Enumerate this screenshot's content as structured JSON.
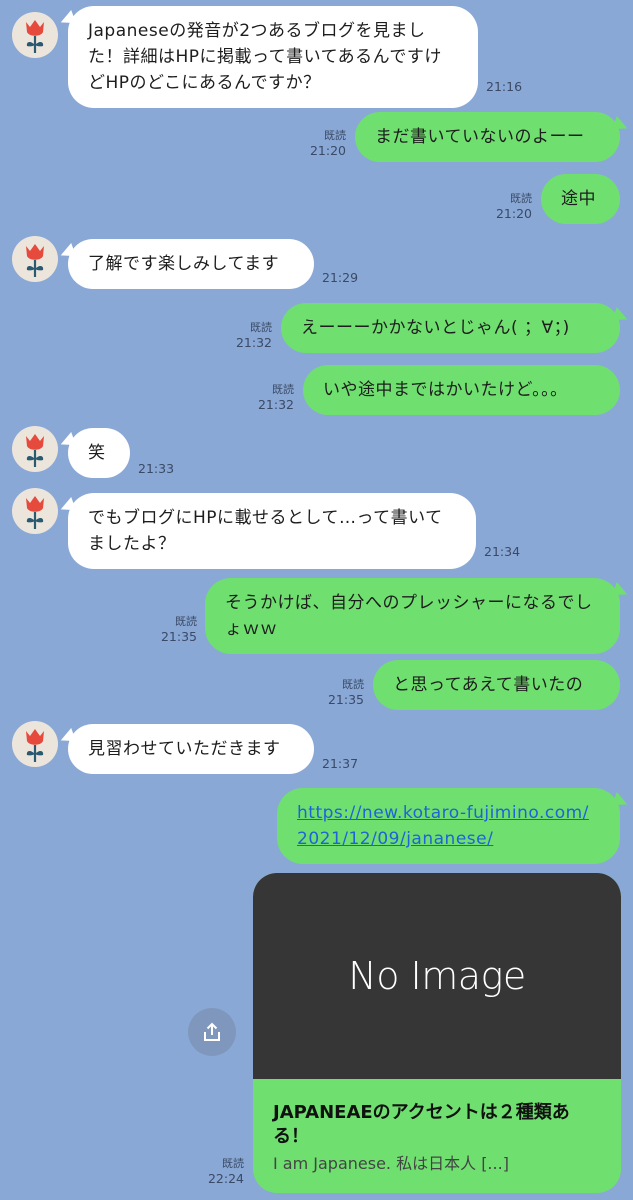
{
  "messages": [
    {
      "text": "Japaneseの発音が2つあるブログを見ました！詳細はHPに掲載って書いてあるんですけどHPのどこにあるんですか？",
      "time": "21:16"
    },
    {
      "text": "まだ書いていないのよーー",
      "read": "既読",
      "time": "21:20"
    },
    {
      "text": "途中",
      "read": "既読",
      "time": "21:20"
    },
    {
      "text": "了解です楽しみしてます",
      "time": "21:29"
    },
    {
      "text": "えーーーかかないとじゃん( ；∀；)",
      "read": "既読",
      "time": "21:32"
    },
    {
      "text": "いや途中まではかいたけど。。。",
      "read": "既読",
      "time": "21:32"
    },
    {
      "text": "笑",
      "time": "21:33"
    },
    {
      "text": "でもブログにHPに載せるとして…って書いてましたよ？",
      "time": "21:34"
    },
    {
      "text": "そうかけば、自分へのプレッシャーになるでしょｗｗ",
      "read": "既読",
      "time": "21:35"
    },
    {
      "text": "と思ってあえて書いたの",
      "read": "既読",
      "time": "21:35"
    },
    {
      "text": "見習わせていただきます",
      "time": "21:37"
    },
    {
      "text": "https://new.kotaro-fujimino.com/2021/12/09/jananese/"
    }
  ],
  "link_card": {
    "image_text": "No Image",
    "title": "JAPANEAEのアクセントは２種類ある！",
    "description": "I am Japanese. 私は日本人 [...]",
    "read": "既読",
    "time": "22:24"
  },
  "icons": {
    "avatar": "red-tulip-icon",
    "share": "share-icon"
  },
  "colors": {
    "background": "#8aa8d6",
    "incoming_bubble": "#ffffff",
    "outgoing_bubble": "#6fe06f",
    "link": "#1e63d6"
  }
}
